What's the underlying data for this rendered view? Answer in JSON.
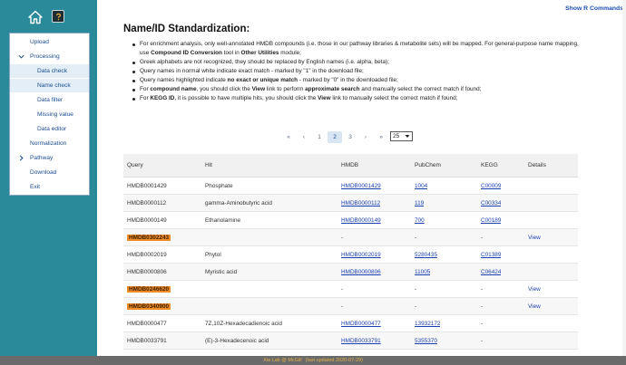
{
  "header": {
    "show_r": "Show R Commands"
  },
  "menu": [
    {
      "label": "Upload",
      "type": "top"
    },
    {
      "label": "Processing",
      "type": "expanded"
    },
    {
      "label": "Data check",
      "type": "sub"
    },
    {
      "label": "Name check",
      "type": "sub"
    },
    {
      "label": "Data filter",
      "type": "plain"
    },
    {
      "label": "Missing value",
      "type": "plain"
    },
    {
      "label": "Data editor",
      "type": "plain"
    },
    {
      "label": "Normalization",
      "type": "top"
    },
    {
      "label": "Pathway",
      "type": "collapsed"
    },
    {
      "label": "Download",
      "type": "top"
    },
    {
      "label": "Exit",
      "type": "top"
    }
  ],
  "page": {
    "title": "Name/ID Standardization:",
    "bullets": [
      "For enrichment analysis, only well-annotated HMDB compounds (i.e. those in our pathway libraries & metabolite sets) will be mapped. For general-purpose name mapping, use <b>Compound ID Conversion</b> tool in <b>Other Utilities</b> module;",
      "Greek alphabets are not recognized, they should be replaced by English names (i.e. alpha, beta);",
      "Query names in normal white indicate exact match - marked by \"1\" in the download file;",
      "Query names highlighted indicate <b>no exact or unique match</b> - marked by \"0\" in the downloaded file;",
      "For <b>compound name</b>, you should click the <b>View</b> link to perform <b>approximate search</b> and manually select the correct match if found;",
      "For <b>KEGG ID</b>, it is possible to have multiple hits, you should click the <b>View</b> link to manually select the correct match if found;"
    ]
  },
  "pager": {
    "first": "«",
    "prev": "‹",
    "pages": [
      "1",
      "2",
      "3"
    ],
    "active": "2",
    "next": "›",
    "last": "»",
    "page_size": "25"
  },
  "table": {
    "headers": {
      "query": "Query",
      "hit": "Hit",
      "hmdb": "HMDB",
      "pubchem": "PubChem",
      "kegg": "KEGG",
      "details": "Details"
    },
    "rows": [
      {
        "query": "HMDB0001429",
        "hit": "Phosphate",
        "hmdb": "HMDB0001429",
        "pubchem": "1004",
        "kegg": "C00009",
        "details": "",
        "highlight": false
      },
      {
        "query": "HMDB0000112",
        "hit": "gamma-Aminobutyric acid",
        "hmdb": "HMDB0000112",
        "pubchem": "119",
        "kegg": "C00334",
        "details": "",
        "highlight": false
      },
      {
        "query": "HMDB0000149",
        "hit": "Ethanolamine",
        "hmdb": "HMDB0000149",
        "pubchem": "700",
        "kegg": "C00189",
        "details": "",
        "highlight": false
      },
      {
        "query": "HMDB0302243",
        "hit": "",
        "hmdb": "-",
        "pubchem": "-",
        "kegg": "-",
        "details": "View",
        "highlight": true
      },
      {
        "query": "HMDB0002019",
        "hit": "Phytol",
        "hmdb": "HMDB0002019",
        "pubchem": "5280435",
        "kegg": "C01389",
        "details": "",
        "highlight": false
      },
      {
        "query": "HMDB0000806",
        "hit": "Myristic acid",
        "hmdb": "HMDB0000806",
        "pubchem": "11005",
        "kegg": "C06424",
        "details": "",
        "highlight": false
      },
      {
        "query": "HMDB0246620",
        "hit": "",
        "hmdb": "-",
        "pubchem": "-",
        "kegg": "-",
        "details": "View",
        "highlight": true
      },
      {
        "query": "HMDB0340900",
        "hit": "",
        "hmdb": "-",
        "pubchem": "-",
        "kegg": "-",
        "details": "View",
        "highlight": true
      },
      {
        "query": "HMDB0000477",
        "hit": "7Z,10Z-Hexadecadienoic acid",
        "hmdb": "HMDB0000477",
        "pubchem": "13932172",
        "kegg": "-",
        "details": "",
        "highlight": false
      },
      {
        "query": "HMDB0033791",
        "hit": "(E)-3-Hexadecenoic acid",
        "hmdb": "HMDB0033791",
        "pubchem": "5355370",
        "kegg": "-",
        "details": "",
        "highlight": false
      }
    ]
  },
  "footer": {
    "lab": "Xia Lab @ McGill",
    "updated": "(last updated 2020-07-29)"
  },
  "colors": {
    "sidebar": "#2a8a99",
    "highlight": "#f08c28",
    "link": "#1a3fb3",
    "footer": "#6a6a6a"
  }
}
